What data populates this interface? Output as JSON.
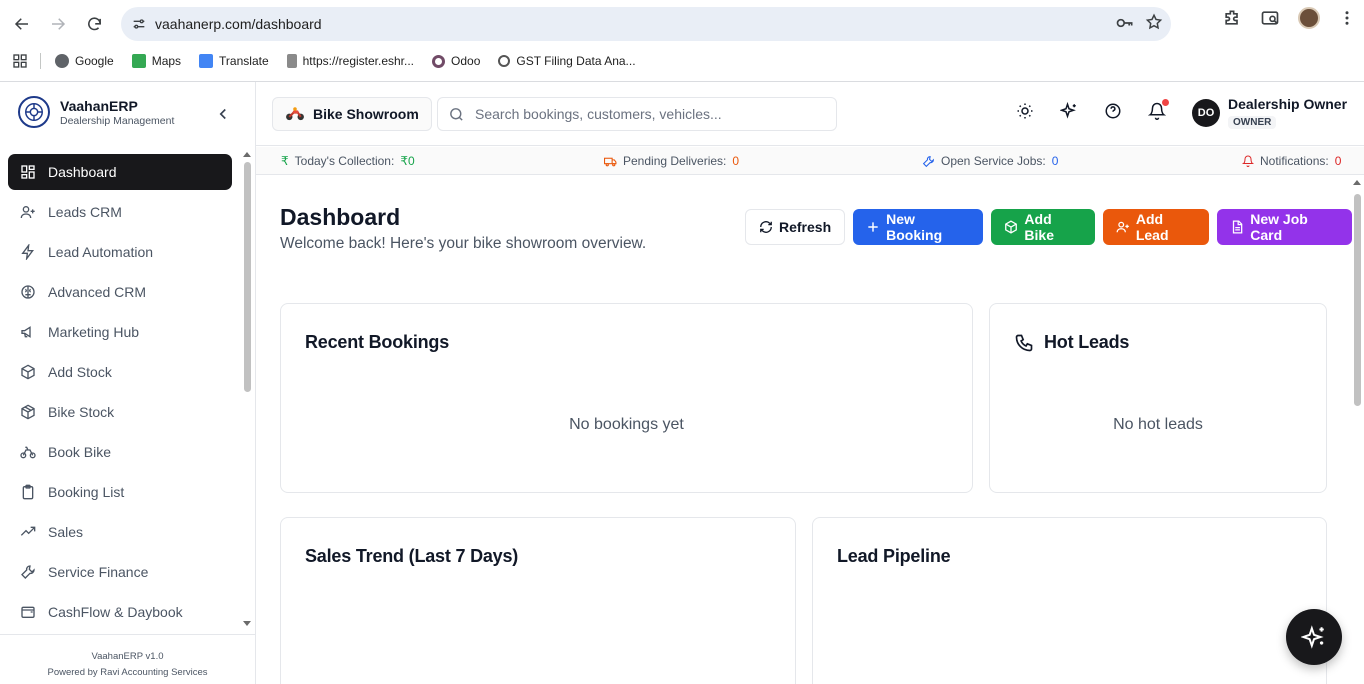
{
  "browser": {
    "url": "vaahanerp.com/dashboard",
    "bookmarks": [
      {
        "label": "Google",
        "icon": "google-icon",
        "color": "#4285f4"
      },
      {
        "label": "Maps",
        "icon": "maps-icon",
        "color": "#34a853"
      },
      {
        "label": "Translate",
        "icon": "translate-icon",
        "color": "#4285f4"
      },
      {
        "label": "https://register.eshr...",
        "icon": "site-icon",
        "color": "#6b7280"
      },
      {
        "label": "Odoo",
        "icon": "odoo-icon",
        "color": "#714b67"
      },
      {
        "label": "GST Filing Data Ana...",
        "icon": "openai-icon",
        "color": "#444444"
      }
    ]
  },
  "brand": {
    "name": "VaahanERP",
    "tagline": "Dealership Management"
  },
  "sidebar": {
    "items": [
      {
        "label": "Dashboard",
        "icon": "dashboard-grid-icon",
        "active": true
      },
      {
        "label": "Leads CRM",
        "icon": "user-plus-icon"
      },
      {
        "label": "Lead Automation",
        "icon": "zap-icon"
      },
      {
        "label": "Advanced CRM",
        "icon": "brain-icon"
      },
      {
        "label": "Marketing Hub",
        "icon": "megaphone-icon"
      },
      {
        "label": "Add Stock",
        "icon": "package-plus-icon"
      },
      {
        "label": "Bike Stock",
        "icon": "package-icon"
      },
      {
        "label": "Book Bike",
        "icon": "bike-icon"
      },
      {
        "label": "Booking List",
        "icon": "clipboard-icon"
      },
      {
        "label": "Sales",
        "icon": "trending-up-icon"
      },
      {
        "label": "Service Finance",
        "icon": "wrench-icon"
      },
      {
        "label": "CashFlow & Daybook",
        "icon": "wallet-icon"
      }
    ],
    "footer_version": "VaahanERP v1.0",
    "footer_powered": "Powered by Ravi Accounting Services"
  },
  "topbar": {
    "store": "Bike Showroom",
    "search_placeholder": "Search bookings, customers, vehicles...",
    "user_initials": "DO",
    "user_name": "Dealership Owner",
    "user_role": "OWNER"
  },
  "stats": {
    "collection_label": "Today's Collection:",
    "collection_value": "₹0",
    "deliveries_label": "Pending Deliveries:",
    "deliveries_value": "0",
    "service_label": "Open Service Jobs:",
    "service_value": "0",
    "notifications_label": "Notifications:",
    "notifications_value": "0",
    "colors": {
      "collection": "#16a34a",
      "deliveries": "#ea580c",
      "service": "#2563eb",
      "notifications": "#dc2626"
    }
  },
  "main": {
    "title": "Dashboard",
    "subtitle": "Welcome back! Here's your bike showroom overview.",
    "actions": {
      "refresh": "Refresh",
      "new_booking": "New Booking",
      "add_bike": "Add Bike",
      "add_lead": "Add Lead",
      "new_job_card": "New Job Card"
    },
    "cards": {
      "recent_bookings": {
        "title": "Recent Bookings",
        "empty": "No bookings yet"
      },
      "hot_leads": {
        "title": "Hot Leads",
        "empty": "No hot leads"
      },
      "sales_trend": {
        "title": "Sales Trend (Last 7 Days)"
      },
      "lead_pipeline": {
        "title": "Lead Pipeline"
      }
    }
  }
}
